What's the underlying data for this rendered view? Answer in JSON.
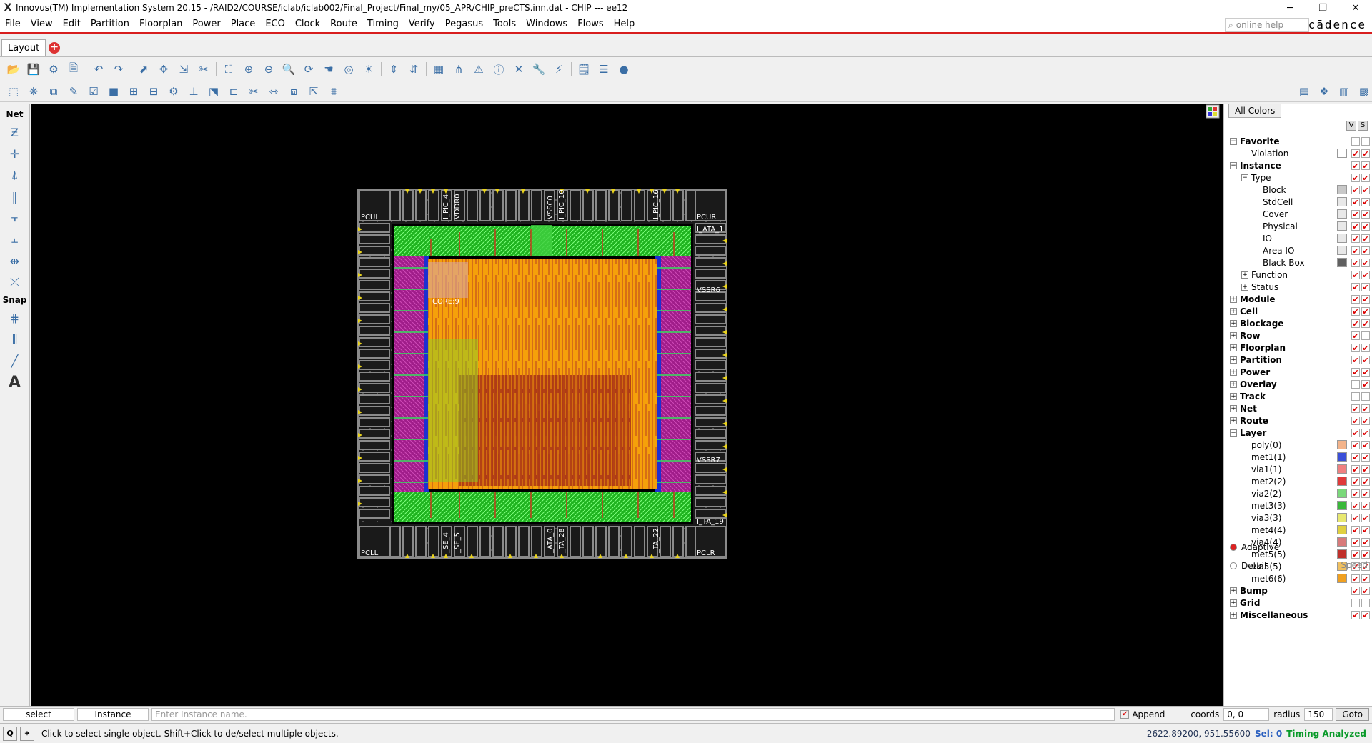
{
  "window": {
    "title": "Innovus(TM) Implementation System 20.15 - /RAID2/COURSE/iclab/iclab002/Final_Project/Final_my/05_APR/CHIP_preCTS.inn.dat - CHIP --- ee12",
    "minimize": "─",
    "maximize": "❐",
    "close": "✕"
  },
  "menubar": {
    "items": [
      "File",
      "View",
      "Edit",
      "Partition",
      "Floorplan",
      "Power",
      "Place",
      "ECO",
      "Clock",
      "Route",
      "Timing",
      "Verify",
      "Pegasus",
      "Tools",
      "Windows",
      "Flows",
      "Help"
    ],
    "search_placeholder": "online help",
    "brand": "cādence"
  },
  "tabs": {
    "active": "Layout"
  },
  "leftbar": {
    "net_label": "Net",
    "snap_label": "Snap",
    "text_tool": "A"
  },
  "chip": {
    "corners": [
      "PCUL",
      "PCUR",
      "PCLL",
      "PCLR"
    ],
    "top_pads": [
      "I_PIC_4",
      "VDDR0",
      "VSSC0",
      "I_PIC_10",
      "I_PIC_16"
    ],
    "bottom_pads": [
      "I_SE_4",
      "I_SE_5",
      "I_ATA_0",
      "I_TA_28",
      "I_TA_22"
    ],
    "right_pads": [
      "I_ATA_1",
      "VSSR6",
      "VSSR7",
      "I_TA_19"
    ],
    "core_label": "CORE:9"
  },
  "rpanel": {
    "all_colors": "All Colors",
    "v": "V",
    "s": "S",
    "tree": [
      {
        "label": "Favorite",
        "level": 0,
        "bold": true,
        "exp": "−"
      },
      {
        "label": "Violation",
        "level": 1,
        "swatch": "#ffffff",
        "c1": true,
        "c2": true
      },
      {
        "label": "Instance",
        "level": 0,
        "bold": true,
        "exp": "−",
        "c1": true,
        "c2": true
      },
      {
        "label": "Type",
        "level": 1,
        "exp": "−",
        "c1": true,
        "c2": true
      },
      {
        "label": "Block",
        "level": 2,
        "swatch": "#c8c8c8",
        "c1": true,
        "c2": true
      },
      {
        "label": "StdCell",
        "level": 2,
        "swatch": "#e8e8e8",
        "c1": true,
        "c2": true
      },
      {
        "label": "Cover",
        "level": 2,
        "swatch": "#e8e8e8",
        "c1": true,
        "c2": true
      },
      {
        "label": "Physical",
        "level": 2,
        "swatch": "#e8e8e8",
        "c1": true,
        "c2": true
      },
      {
        "label": "IO",
        "level": 2,
        "swatch": "#e8e8e8",
        "c1": true,
        "c2": true
      },
      {
        "label": "Area IO",
        "level": 2,
        "swatch": "#e8e8e8",
        "c1": true,
        "c2": true
      },
      {
        "label": "Black Box",
        "level": 2,
        "swatch": "#606060",
        "c1": true,
        "c2": true
      },
      {
        "label": "Function",
        "level": 1,
        "exp": "+",
        "c1": true,
        "c2": true
      },
      {
        "label": "Status",
        "level": 1,
        "exp": "+",
        "c1": true,
        "c2": true
      },
      {
        "label": "Module",
        "level": 0,
        "bold": true,
        "exp": "+",
        "c1": true,
        "c2": true
      },
      {
        "label": "Cell",
        "level": 0,
        "bold": true,
        "exp": "+",
        "c1": true,
        "c2": true
      },
      {
        "label": "Blockage",
        "level": 0,
        "bold": true,
        "exp": "+",
        "c1": true,
        "c2": true
      },
      {
        "label": "Row",
        "level": 0,
        "bold": true,
        "exp": "+",
        "c1": true,
        "c2": false
      },
      {
        "label": "Floorplan",
        "level": 0,
        "bold": true,
        "exp": "+",
        "c1": true,
        "c2": true
      },
      {
        "label": "Partition",
        "level": 0,
        "bold": true,
        "exp": "+",
        "c1": true,
        "c2": true
      },
      {
        "label": "Power",
        "level": 0,
        "bold": true,
        "exp": "+",
        "c1": true,
        "c2": true
      },
      {
        "label": "Overlay",
        "level": 0,
        "bold": true,
        "exp": "+",
        "c1": false,
        "c2": true
      },
      {
        "label": "Track",
        "level": 0,
        "bold": true,
        "exp": "+",
        "c1": false,
        "c2": false
      },
      {
        "label": "Net",
        "level": 0,
        "bold": true,
        "exp": "+",
        "c1": true,
        "c2": true
      },
      {
        "label": "Route",
        "level": 0,
        "bold": true,
        "exp": "+",
        "c1": true,
        "c2": true
      },
      {
        "label": "Layer",
        "level": 0,
        "bold": true,
        "exp": "−",
        "c1": true,
        "c2": true
      },
      {
        "label": "poly(0)",
        "level": 1,
        "swatch": "#f3b38a",
        "c1": true,
        "c2": true
      },
      {
        "label": "met1(1)",
        "level": 1,
        "swatch": "#3a4fd8",
        "c1": true,
        "c2": true
      },
      {
        "label": "via1(1)",
        "level": 1,
        "swatch": "#f08080",
        "c1": true,
        "c2": true
      },
      {
        "label": "met2(2)",
        "level": 1,
        "swatch": "#e03a3a",
        "c1": true,
        "c2": true
      },
      {
        "label": "via2(2)",
        "level": 1,
        "swatch": "#7ad87a",
        "c1": true,
        "c2": true
      },
      {
        "label": "met3(3)",
        "level": 1,
        "swatch": "#3ab83a",
        "c1": true,
        "c2": true
      },
      {
        "label": "via3(3)",
        "level": 1,
        "swatch": "#e8e870",
        "c1": true,
        "c2": true
      },
      {
        "label": "met4(4)",
        "level": 1,
        "swatch": "#e0d040",
        "c1": true,
        "c2": true
      },
      {
        "label": "via4(4)",
        "level": 1,
        "swatch": "#d87a7a",
        "c1": true,
        "c2": true
      },
      {
        "label": "met5(5)",
        "level": 1,
        "swatch": "#c0302a",
        "c1": true,
        "c2": true
      },
      {
        "label": "via5(5)",
        "level": 1,
        "swatch": "#f0c060",
        "c1": true,
        "c2": true
      },
      {
        "label": "met6(6)",
        "level": 1,
        "swatch": "#f0a020",
        "c1": true,
        "c2": true
      },
      {
        "label": "Bump",
        "level": 0,
        "bold": true,
        "exp": "+",
        "c1": true,
        "c2": true
      },
      {
        "label": "Grid",
        "level": 0,
        "bold": true,
        "exp": "+",
        "c1": false,
        "c2": false
      },
      {
        "label": "Miscellaneous",
        "level": 0,
        "bold": true,
        "exp": "+",
        "c1": true,
        "c2": true
      }
    ],
    "adaptive": "Adaptive",
    "detail": "Detail",
    "speed": "Speed"
  },
  "cmdbar": {
    "mode": "select",
    "type": "Instance",
    "input_placeholder": "Enter Instance name.",
    "append": "Append",
    "coords_label": "coords",
    "coords_value": "0, 0",
    "radius_label": "radius",
    "radius_value": "150",
    "goto": "Goto"
  },
  "status": {
    "message": "Click to select single object. Shift+Click to de/select multiple objects.",
    "coords": "2622.89200, 951.55600",
    "sel": "Sel: 0",
    "timing": "Timing Analyzed"
  }
}
